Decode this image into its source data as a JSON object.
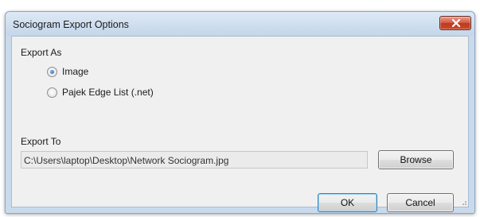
{
  "dialog": {
    "title": "Sociogram Export Options",
    "close_label": "close",
    "export_as": {
      "label": "Export As",
      "options": [
        {
          "label": "Image",
          "checked": true
        },
        {
          "label": "Pajek Edge List (.net)",
          "checked": false
        }
      ]
    },
    "export_to": {
      "label": "Export To",
      "path": "C:\\Users\\laptop\\Desktop\\Network Sociogram.jpg",
      "browse_label": "Browse"
    },
    "buttons": {
      "ok_label": "OK",
      "cancel_label": "Cancel"
    },
    "colors": {
      "frame": "#c9daec",
      "client": "#f0f0f0",
      "close_button": "#c9492d",
      "radio_selected": "#1f5ea8"
    }
  }
}
